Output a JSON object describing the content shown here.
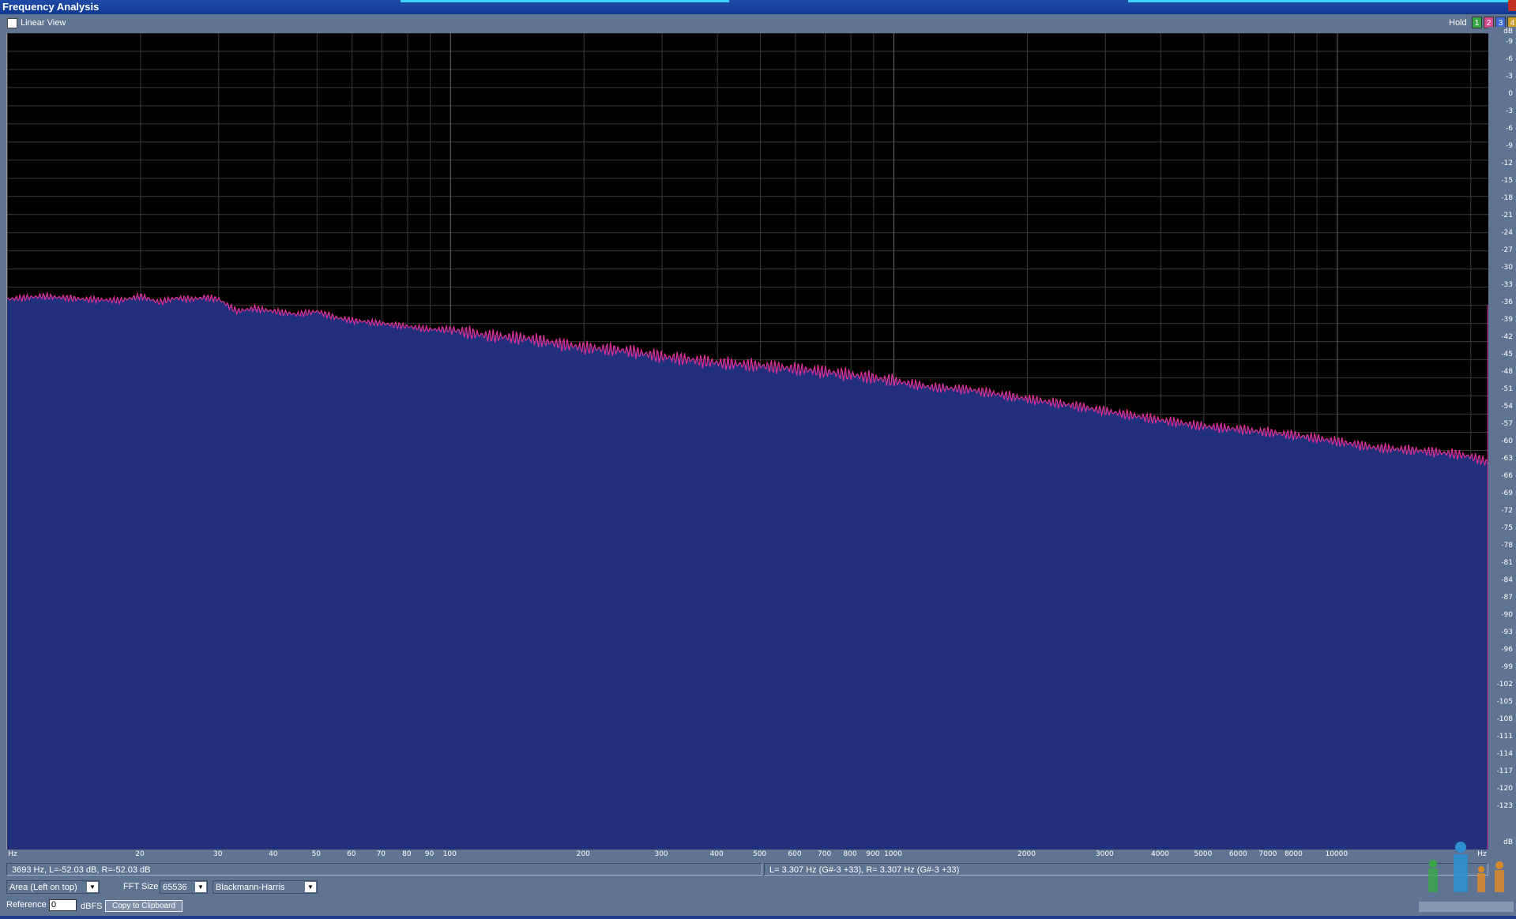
{
  "window": {
    "title": "Frequency Analysis"
  },
  "toolbar": {
    "linear_view_label": "Linear View",
    "hold_label": "Hold",
    "hold_buttons": [
      {
        "label": "1",
        "color": "#3aa648"
      },
      {
        "label": "2",
        "color": "#d44c8a"
      },
      {
        "label": "3",
        "color": "#3f6bd6"
      },
      {
        "label": "4",
        "color": "#c9a12b"
      }
    ]
  },
  "axes": {
    "y_unit": "dB",
    "x_unit": "Hz",
    "y_ticks": [
      "-9",
      "-6",
      "-3",
      "0",
      "-3",
      "-6",
      "-9",
      "-12",
      "-15",
      "-18",
      "-21",
      "-24",
      "-27",
      "-30",
      "-33",
      "-36",
      "-39",
      "-42",
      "-45",
      "-48",
      "-51",
      "-54",
      "-57",
      "-60",
      "-63",
      "-66",
      "-69",
      "-72",
      "-75",
      "-78",
      "-81",
      "-84",
      "-87",
      "-90",
      "-93",
      "-96",
      "-99",
      "-102",
      "-105",
      "-108",
      "-111",
      "-114",
      "-117",
      "-120",
      "-123"
    ],
    "x_ticks": [
      {
        "f": 20,
        "label": "20"
      },
      {
        "f": 30,
        "label": "30"
      },
      {
        "f": 40,
        "label": "40"
      },
      {
        "f": 50,
        "label": "50"
      },
      {
        "f": 60,
        "label": "60"
      },
      {
        "f": 70,
        "label": "70"
      },
      {
        "f": 80,
        "label": "80"
      },
      {
        "f": 90,
        "label": "90"
      },
      {
        "f": 100,
        "label": "100"
      },
      {
        "f": 200,
        "label": "200"
      },
      {
        "f": 300,
        "label": "300"
      },
      {
        "f": 400,
        "label": "400"
      },
      {
        "f": 500,
        "label": "500"
      },
      {
        "f": 600,
        "label": "600"
      },
      {
        "f": 700,
        "label": "700"
      },
      {
        "f": 800,
        "label": "800"
      },
      {
        "f": 900,
        "label": "900"
      },
      {
        "f": 1000,
        "label": "1000"
      },
      {
        "f": 2000,
        "label": "2000"
      },
      {
        "f": 3000,
        "label": "3000"
      },
      {
        "f": 4000,
        "label": "4000"
      },
      {
        "f": 5000,
        "label": "5000"
      },
      {
        "f": 6000,
        "label": "6000"
      },
      {
        "f": 7000,
        "label": "7000"
      },
      {
        "f": 8000,
        "label": "8000"
      },
      {
        "f": 10000,
        "label": "10000"
      }
    ]
  },
  "chart_data": {
    "type": "area",
    "xscale": "log",
    "xlim": [
      10,
      22000
    ],
    "ylim": [
      -126,
      9
    ],
    "grid": true,
    "fill_color": "#222f7a",
    "line_color": "#e0309a",
    "series": [
      {
        "x": [
          10,
          12,
          15,
          18,
          20,
          22,
          24,
          26,
          28,
          30,
          33,
          36,
          40,
          45,
          50,
          55,
          60,
          70,
          80,
          90,
          100,
          120,
          150,
          180,
          200,
          250,
          300,
          400,
          500,
          600,
          700,
          800,
          1000,
          1200,
          1500,
          2000,
          2500,
          3000,
          4000,
          5000,
          6000,
          7000,
          8000,
          9000,
          10000,
          12000,
          15000,
          18000,
          20000,
          22000
        ],
        "y": [
          -35,
          -34.5,
          -35,
          -35.2,
          -34.5,
          -35.5,
          -34.8,
          -35,
          -34.7,
          -35,
          -37,
          -36.5,
          -37,
          -37.5,
          -37,
          -38,
          -38.5,
          -39,
          -39.5,
          -40,
          -40,
          -41,
          -41.5,
          -42.5,
          -43,
          -43.5,
          -44.5,
          -45.5,
          -46,
          -46.5,
          -47,
          -47.5,
          -48.5,
          -49.5,
          -50,
          -51.5,
          -52.5,
          -53.5,
          -55,
          -56,
          -56.5,
          -57,
          -57.5,
          -58,
          -58.5,
          -59.5,
          -60,
          -60.5,
          -61,
          -62
        ]
      }
    ]
  },
  "status": {
    "cursor_readout": "3693 Hz, L=-52.03 dB, R=-52.03 dB",
    "peak_readout": "L=  3.307 Hz (G#-3 +33), R=  3.307 Hz (G#-3 +33)"
  },
  "controls": {
    "view_mode": "Area (Left on top)",
    "fft_size_label": "FFT Size",
    "fft_size": "65536",
    "window_fn": "Blackmann-Harris",
    "reference_label": "Reference",
    "reference_value": "0",
    "reference_unit": "dBFS",
    "copy_label": "Copy to Clipboard"
  }
}
